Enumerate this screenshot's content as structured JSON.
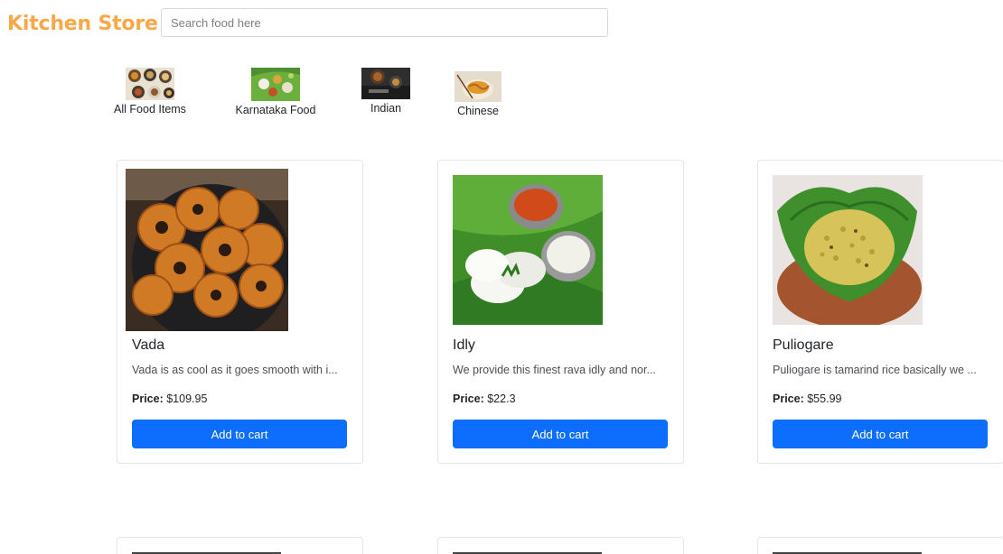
{
  "header": {
    "brand": "Kitchen Store",
    "search_placeholder": "Search food here",
    "search_value": ""
  },
  "categories": [
    {
      "label": "All Food Items",
      "icon": "food-platter-icon"
    },
    {
      "label": "Karnataka Food",
      "icon": "banana-leaf-meal-icon"
    },
    {
      "label": "Indian",
      "icon": "indian-dish-icon"
    },
    {
      "label": "Chinese",
      "icon": "noodle-bowl-icon"
    }
  ],
  "products": [
    {
      "name": "Vada",
      "description": "Vada is as cool as it goes smooth with i...",
      "price_label": "Price:",
      "price": "$109.95",
      "button": "Add to cart"
    },
    {
      "name": "Idly",
      "description": "We provide this finest rava idly and nor...",
      "price_label": "Price:",
      "price": "$22.3",
      "button": "Add to cart"
    },
    {
      "name": "Puliogare",
      "description": "Puliogare is tamarind rice basically we ...",
      "price_label": "Price:",
      "price": "$55.99",
      "button": "Add to cart"
    }
  ],
  "colors": {
    "brand": "#f7a848",
    "primary_button": "#0d6efd",
    "card_border": "#e3e5e8"
  }
}
